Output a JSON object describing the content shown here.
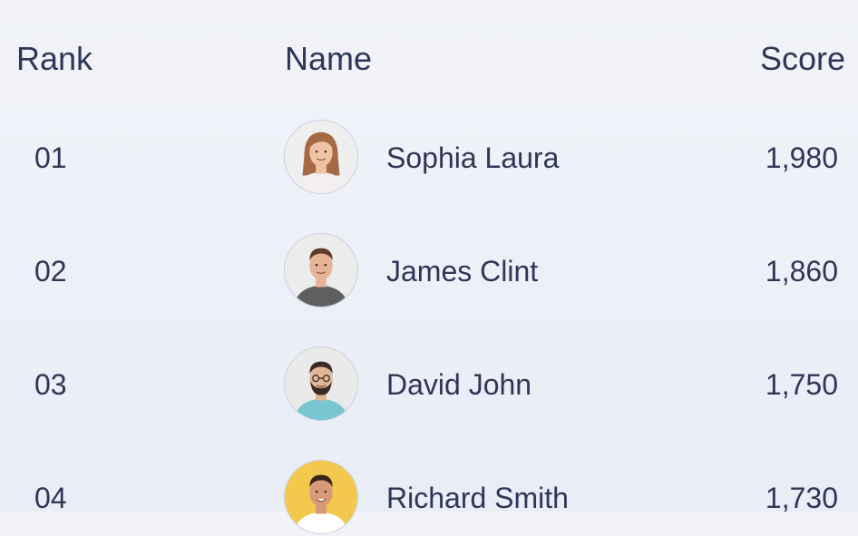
{
  "headers": {
    "rank": "Rank",
    "name": "Name",
    "score": "Score"
  },
  "rows": [
    {
      "rank": "01",
      "name": "Sophia Laura",
      "score": "1,980",
      "avatar": {
        "icon": "avatar-woman-icon",
        "background": "#efefef",
        "hair": "#a56a45",
        "skin": "#f1c3a5",
        "shirt": "#f3eef0"
      }
    },
    {
      "rank": "02",
      "name": "James Clint",
      "score": "1,860",
      "avatar": {
        "icon": "avatar-man-icon",
        "background": "#ececec",
        "hair": "#5c3b2a",
        "skin": "#e7b395",
        "shirt": "#5f5f5f"
      }
    },
    {
      "rank": "03",
      "name": "David John",
      "score": "1,750",
      "avatar": {
        "icon": "avatar-bearded-man-icon",
        "background": "#eaeaea",
        "hair": "#3a2b24",
        "skin": "#e2b597",
        "shirt": "#78c6d2"
      }
    },
    {
      "rank": "04",
      "name": "Richard Smith",
      "score": "1,730",
      "avatar": {
        "icon": "avatar-smiling-man-icon",
        "background": "#f2c94c",
        "hair": "#3b2418",
        "skin": "#d79a78",
        "shirt": "#ffffff"
      }
    }
  ]
}
